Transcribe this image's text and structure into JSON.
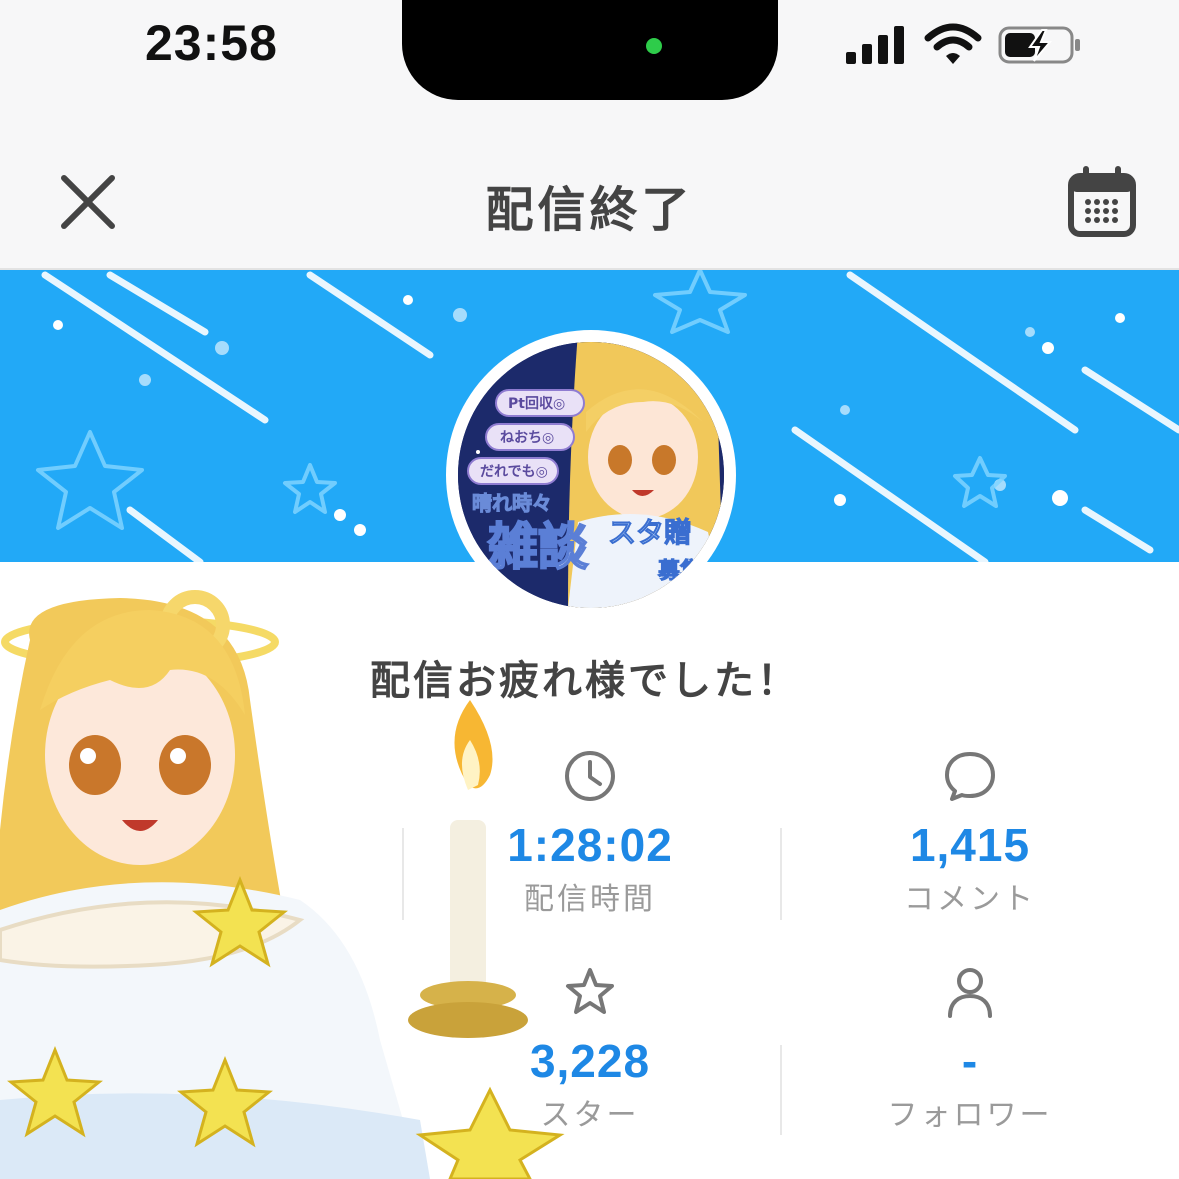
{
  "status_bar": {
    "time": "23:58"
  },
  "header": {
    "title": "配信終了",
    "close_icon": "close-icon",
    "calendar_icon": "calendar-icon"
  },
  "avatar": {
    "tags": [
      "Pt回収◎",
      "ねおち◎",
      "だれでも◎"
    ],
    "caption_small": "晴れ時々",
    "caption_big": "雑談",
    "caption_side": "スタ贈",
    "caption_side2": "募集"
  },
  "message": "配信お疲れ様でした！",
  "stats": {
    "duration": {
      "icon": "clock-icon",
      "value": "1:28:02",
      "label": "配信時間"
    },
    "comments": {
      "icon": "comment-icon",
      "value": "1,415",
      "label": "コメント"
    },
    "stars": {
      "icon": "star-icon",
      "value": "3,228",
      "label": "スター"
    },
    "followers": {
      "icon": "person-icon",
      "value": "-",
      "label": "フォロワー"
    }
  },
  "colors": {
    "banner": "#22a9f7",
    "accent_value": "#1e88e5",
    "label": "#9a9a9a"
  }
}
